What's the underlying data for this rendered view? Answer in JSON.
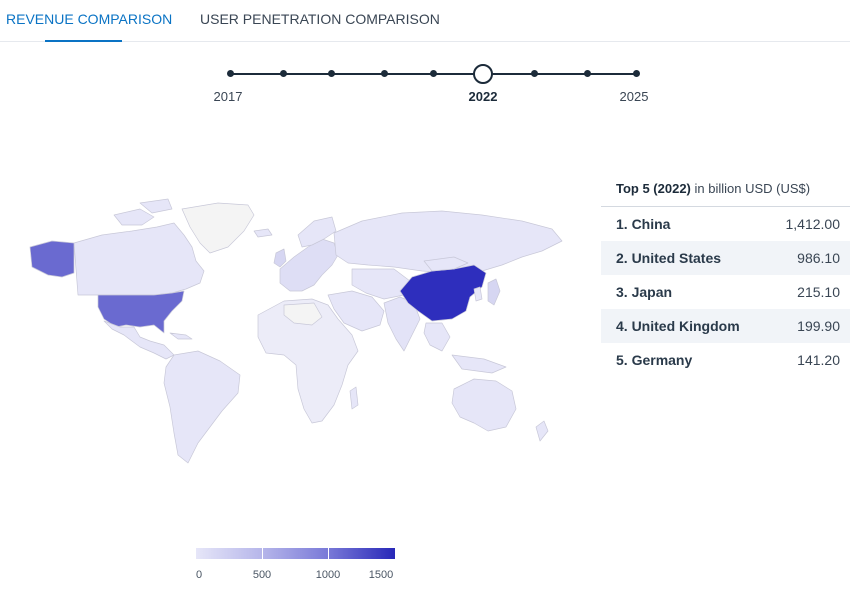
{
  "tabs": {
    "revenue": "REVENUE COMPARISON",
    "users": "USER PENETRATION COMPARISON"
  },
  "timeline": {
    "start": "2017",
    "selected": "2022",
    "end": "2025"
  },
  "legend": {
    "ticks": [
      "0",
      "500",
      "1000",
      "1500"
    ],
    "color_min": "#e6e6f8",
    "color_max": "#2828b8"
  },
  "ranking": {
    "title": "Top 5 (2022)",
    "subtitle": " in billion USD (US$)",
    "rows": [
      {
        "name": "1. China",
        "value": "1,412.00"
      },
      {
        "name": "2. United States",
        "value": "986.10"
      },
      {
        "name": "3. Japan",
        "value": "215.10"
      },
      {
        "name": "4. United Kingdom",
        "value": "199.90"
      },
      {
        "name": "5. Germany",
        "value": "141.20"
      }
    ]
  },
  "colors": {
    "accent": "#0a73c4",
    "map_low": "#e6e6f8",
    "map_china": "#2e2ebd",
    "map_us": "#6a6ad0",
    "map_alaska": "#6a6ad0",
    "map_nodata": "#f4f4f4"
  }
}
